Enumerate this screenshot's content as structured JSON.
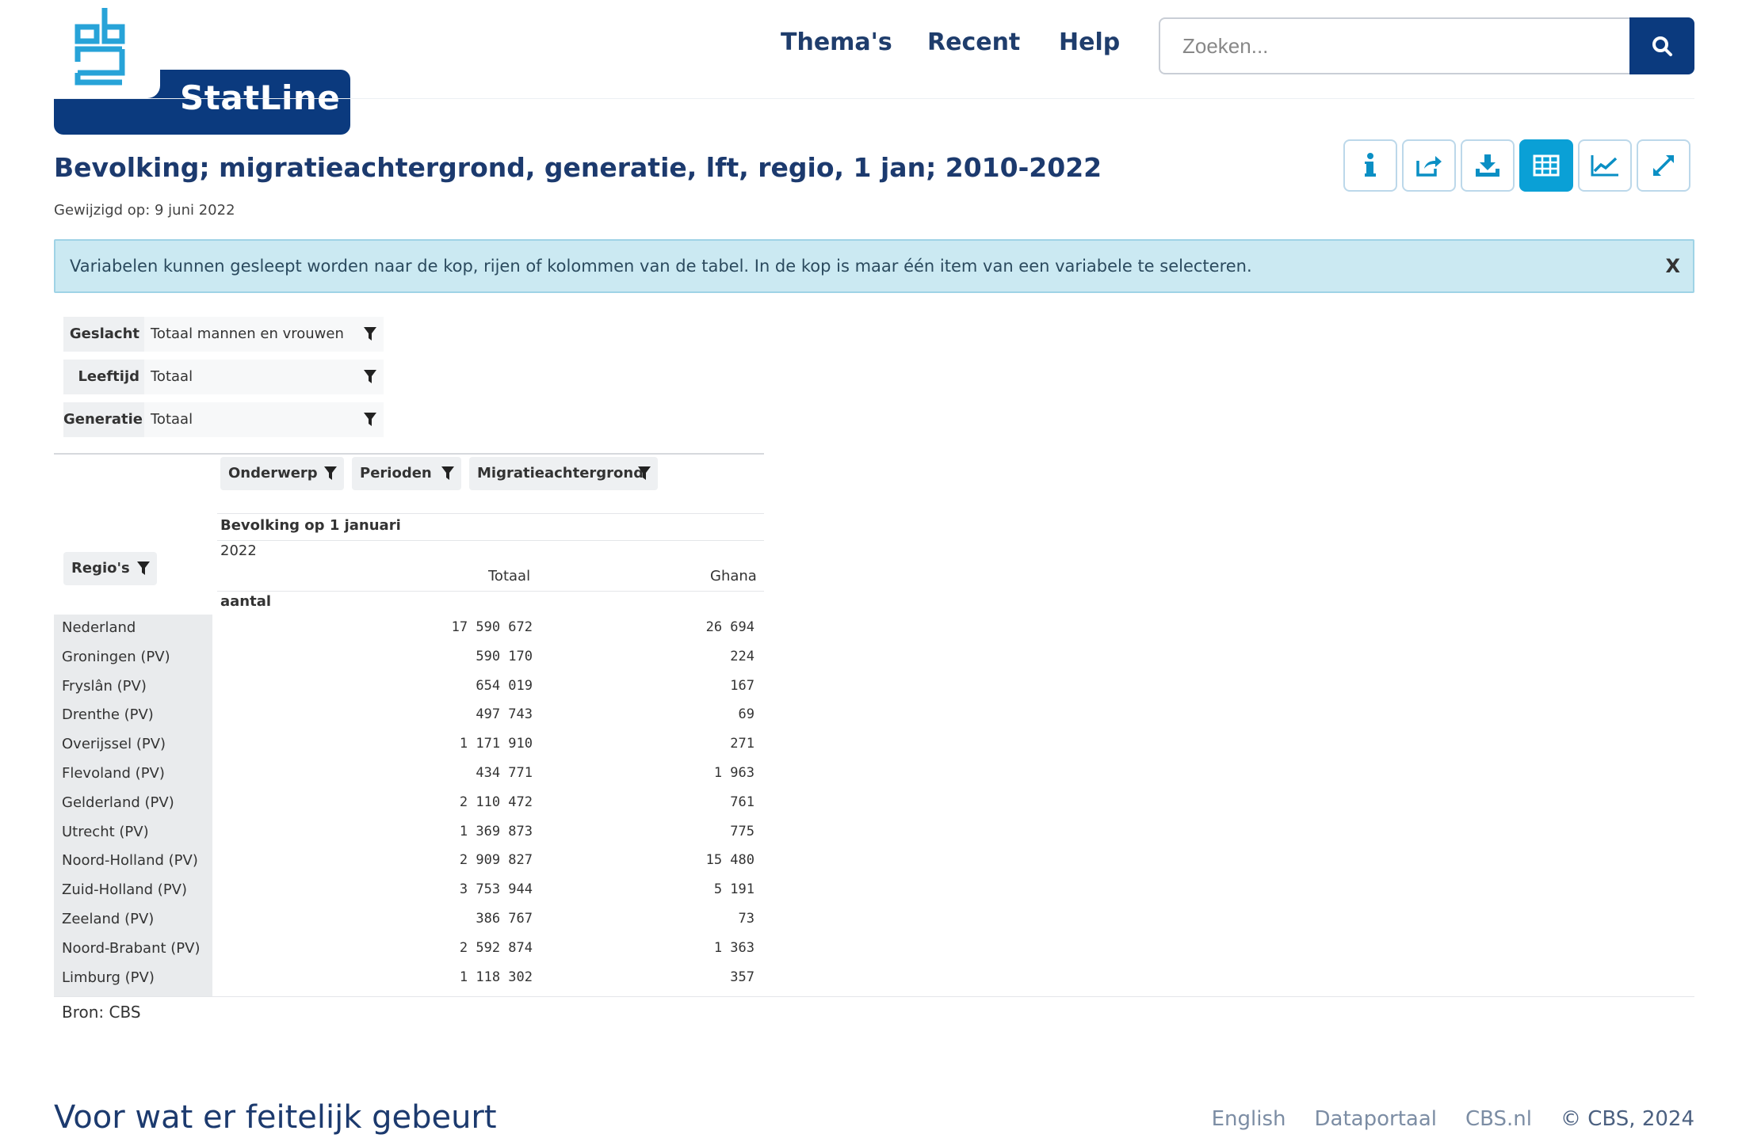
{
  "brand": {
    "name": "StatLine",
    "primary_color": "#0b3a7e",
    "accent_color": "#0aa0d6"
  },
  "nav": {
    "themas": "Thema's",
    "recent": "Recent",
    "help": "Help"
  },
  "search": {
    "placeholder": "Zoeken..."
  },
  "page": {
    "title": "Bevolking; migratieachtergrond, generatie, lft, regio, 1 jan; 2010-2022",
    "modified": "Gewijzigd op: 9 juni 2022"
  },
  "toolbar": {
    "icons": [
      "info-icon",
      "share-icon",
      "download-icon",
      "table-icon",
      "chart-icon",
      "fullscreen-icon"
    ],
    "active": "table-icon"
  },
  "banner": {
    "text": "Variabelen kunnen gesleept worden naar de kop, rijen of kolommen van de tabel. In de kop is maar één item van een variabele te selecteren.",
    "close": "X"
  },
  "filters": [
    {
      "label": "Geslacht",
      "value": "Totaal mannen en vrouwen"
    },
    {
      "label": "Leeftijd",
      "value": "Totaal"
    },
    {
      "label": "Generatie",
      "value": "Totaal"
    }
  ],
  "column_chips": [
    "Onderwerp",
    "Perioden",
    "Migratieachtergrond"
  ],
  "row_chip": "Regio's",
  "table": {
    "subject": "Bevolking op 1 januari",
    "period": "2022",
    "col_totaal": "Totaal",
    "col_ghana": "Ghana",
    "unit": "aantal",
    "rows": [
      {
        "region": "Nederland",
        "totaal": "17 590 672",
        "ghana": "26 694"
      },
      {
        "region": "Groningen (PV)",
        "totaal": "590 170",
        "ghana": "224"
      },
      {
        "region": "Fryslân (PV)",
        "totaal": "654 019",
        "ghana": "167"
      },
      {
        "region": "Drenthe (PV)",
        "totaal": "497 743",
        "ghana": "69"
      },
      {
        "region": "Overijssel (PV)",
        "totaal": "1 171 910",
        "ghana": "271"
      },
      {
        "region": "Flevoland (PV)",
        "totaal": "434 771",
        "ghana": "1 963"
      },
      {
        "region": "Gelderland (PV)",
        "totaal": "2 110 472",
        "ghana": "761"
      },
      {
        "region": "Utrecht (PV)",
        "totaal": "1 369 873",
        "ghana": "775"
      },
      {
        "region": "Noord-Holland (PV)",
        "totaal": "2 909 827",
        "ghana": "15 480"
      },
      {
        "region": "Zuid-Holland (PV)",
        "totaal": "3 753 944",
        "ghana": "5 191"
      },
      {
        "region": "Zeeland (PV)",
        "totaal": "386 767",
        "ghana": "73"
      },
      {
        "region": "Noord-Brabant (PV)",
        "totaal": "2 592 874",
        "ghana": "1 363"
      },
      {
        "region": "Limburg (PV)",
        "totaal": "1 118 302",
        "ghana": "357"
      }
    ]
  },
  "source": "Bron: CBS",
  "footer": {
    "tagline": "Voor wat er feitelijk gebeurt",
    "links": [
      "English",
      "Dataportaal",
      "CBS.nl"
    ],
    "copyright": "© CBS, 2024"
  }
}
